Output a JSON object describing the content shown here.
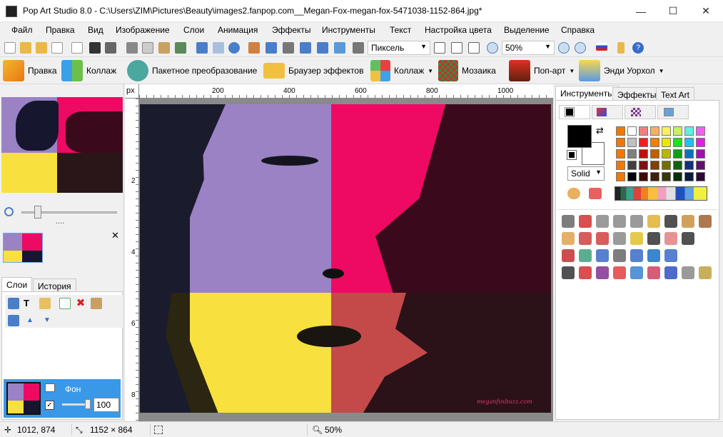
{
  "window": {
    "title": "Pop Art Studio 8.0 - C:\\Users\\ZIM\\Pictures\\Beauty\\images2.fanpop.com__Megan-Fox-megan-fox-5471038-1152-864.jpg*",
    "minimize": "—",
    "maximize": "☐",
    "close": "✕"
  },
  "menu": [
    "Файл",
    "Правка",
    "Вид",
    "Изображение",
    "Слои",
    "Анимация",
    "Эффекты",
    "Инструменты",
    "Текст",
    "Настройка цвета",
    "Выделение",
    "Справка"
  ],
  "toolbar": {
    "unit_select": "Пиксель",
    "zoom_select": "50%"
  },
  "toolbar2": {
    "edit": "Правка",
    "collage": "Коллаж",
    "batch": "Пакетное преобразование",
    "browser": "Браузер эффектов",
    "collage2": "Коллаж",
    "mosaic": "Мозаика",
    "popart": "Поп-арт",
    "warhol": "Энди Уорхол"
  },
  "left": {
    "ellipsis": "....",
    "close": "✕",
    "tabs": [
      "Слои",
      "История"
    ],
    "layer_name": "Фон",
    "opacity": "100"
  },
  "ruler": {
    "unit": "px",
    "top_labels": [
      "200",
      "400",
      "600",
      "800",
      "1000"
    ],
    "left_labels": [
      "2",
      "4",
      "6",
      "8"
    ]
  },
  "canvas": {
    "watermark": "meganfoxbuzz.com"
  },
  "right": {
    "tabs": [
      "Инструменты",
      "Эффекты",
      "Text Art"
    ],
    "brush_mode": "Solid"
  },
  "status": {
    "coords": "1012, 874",
    "size": "1152 × 864",
    "zoom": "50%"
  },
  "colors": {
    "purple": "#9a82c4",
    "pink": "#ee0a62",
    "yellow": "#f8e03e",
    "maroon": "#3a0a1c",
    "darkolive": "#2a2612",
    "salmon": "#c44a4a",
    "navy": "#16172e"
  }
}
